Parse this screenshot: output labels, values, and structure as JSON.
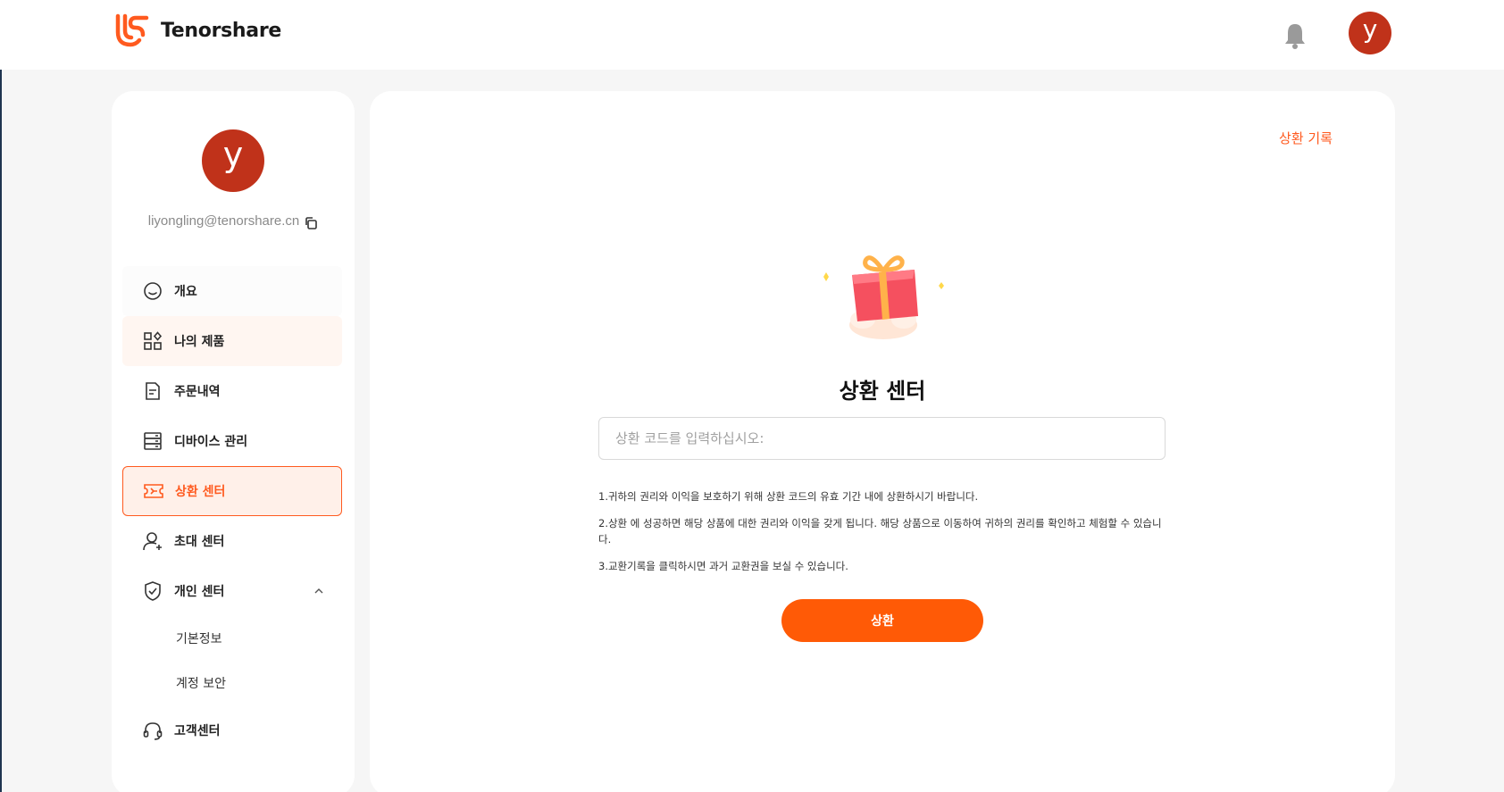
{
  "header": {
    "brand": "Tenorshare",
    "avatar_letter": "y"
  },
  "sidebar": {
    "avatar_letter": "y",
    "email": "liyongling@tenorshare.cn",
    "items": [
      {
        "label": "개요",
        "icon": "smile-icon"
      },
      {
        "label": "나의 제품",
        "icon": "apps-icon"
      },
      {
        "label": "주문내역",
        "icon": "document-icon"
      },
      {
        "label": "디바이스 관리",
        "icon": "server-icon"
      },
      {
        "label": "상환 센터",
        "icon": "ticket-icon",
        "active": true
      },
      {
        "label": "초대 센터",
        "icon": "user-add-icon"
      },
      {
        "label": "개인 센터",
        "icon": "shield-check-icon",
        "expanded": true
      },
      {
        "label": "고객센터",
        "icon": "headset-icon"
      }
    ],
    "sub_items": [
      {
        "label": "기본정보"
      },
      {
        "label": "계정 보안"
      }
    ]
  },
  "main": {
    "history_link": "상환 기록",
    "title": "상환 센터",
    "input_placeholder": "상환 코드를 입력하십시오:",
    "input_value": "",
    "notes": [
      "1.귀하의 권리와 이익을 보호하기 위해 상환 코드의 유효 기간 내에 상환하시기 바랍니다.",
      "2.상환 에 성공하면 해당 상품에 대한 권리와 이익을 갖게 됩니다. 해당 상품으로 이동하여 귀하의 권리를 확인하고 체험할 수 있습니다.",
      "3.교환기록을 클릭하시면 과거 교환권을 보실 수 있습니다."
    ],
    "redeem_button": "상환"
  },
  "colors": {
    "accent": "#ff5a06",
    "avatar": "#c0321a",
    "active_bg": "#fff0e9"
  }
}
